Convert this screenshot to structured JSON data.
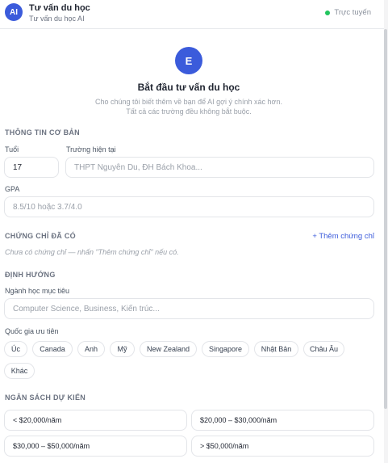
{
  "header": {
    "avatar": "AI",
    "title": "Tư vấn du học",
    "subtitle": "Tư vấn du học AI",
    "status": "Trực tuyến"
  },
  "hero": {
    "icon_letter": "E",
    "title": "Bắt đầu tư vấn du học",
    "desc_line1": "Cho chúng tôi biết thêm về bạn để AI gợi ý chính xác hơn.",
    "desc_line2": "Tất cả các trường đều không bắt buộc."
  },
  "basic": {
    "section": "THÔNG TIN CƠ BẢN",
    "age_label": "Tuổi",
    "age_value": "17",
    "school_label": "Trường hiện tại",
    "school_placeholder": "THPT Nguyễn Du, ĐH Bách Khoa...",
    "gpa_label": "GPA",
    "gpa_placeholder": "8.5/10 hoặc 3.7/4.0"
  },
  "certs": {
    "section": "CHỨNG CHỈ ĐÃ CÓ",
    "add_label": "+ Thêm chứng chỉ",
    "hint": "Chưa có chứng chỉ — nhấn \"Thêm chứng chỉ\" nếu có."
  },
  "direction": {
    "section": "ĐỊNH HƯỚNG",
    "major_label": "Ngành học mục tiêu",
    "major_placeholder": "Computer Science, Business, Kiến trúc...",
    "country_label": "Quốc gia ưu tiên",
    "countries": [
      "Úc",
      "Canada",
      "Anh",
      "Mỹ",
      "New Zealand",
      "Singapore",
      "Nhật Bản",
      "Châu Âu",
      "Khác"
    ]
  },
  "budget": {
    "section": "NGÂN SÁCH DỰ KIẾN",
    "options": [
      "< $20,000/năm",
      "$20,000 – $30,000/năm",
      "$30,000 – $50,000/năm",
      "> $50,000/năm"
    ]
  },
  "colors": {
    "accent": "#3b5bdb",
    "online": "#22c55e"
  }
}
